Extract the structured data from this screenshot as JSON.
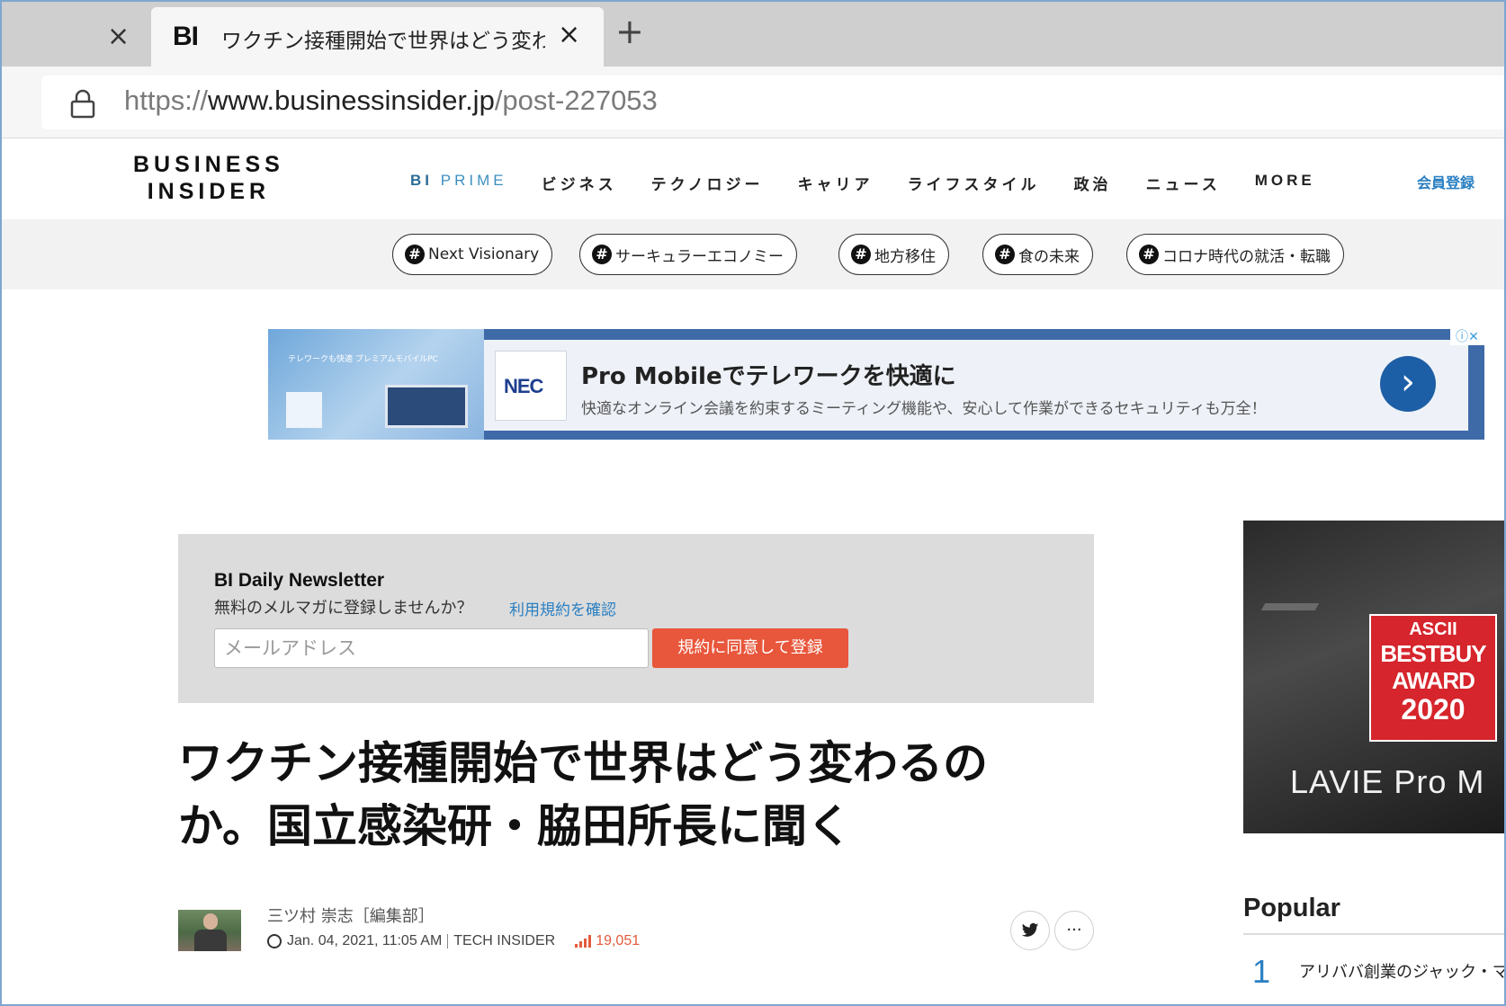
{
  "browser": {
    "closed_tab_close": "×",
    "active_tab": {
      "favicon": "BI",
      "title": "ワクチン接種開始で世界はどう変わる",
      "close": "×"
    },
    "new_tab": "+",
    "url_scheme": "https://",
    "url_domain": "www.businessinsider.jp",
    "url_path": "/post-227053"
  },
  "site": {
    "logo_line1": "BUSINESS",
    "logo_line2": "INSIDER",
    "nav": {
      "prime_bi": "BI",
      "prime": "PRIME",
      "items": [
        "ビジネス",
        "テクノロジー",
        "キャリア",
        "ライフスタイル",
        "政治",
        "ニュース",
        "MORE"
      ]
    },
    "member_link": "会員登録",
    "tags": [
      "Next Visionary",
      "サーキュラーエコノミー",
      "地方移住",
      "食の未来",
      "コロナ時代の就活・転職"
    ],
    "tag_hash": "#"
  },
  "ad": {
    "image_text": "テレワークも快適 プレミアムモバイルPC",
    "brand": "NEC",
    "title": "Pro Mobileでテレワークを快適に",
    "subtitle": "快適なオンライン会議を約束するミーティング機能や、安心して作業ができるセキュリティも万全！",
    "cta": "›",
    "adchoices": "ⓘ✕"
  },
  "newsletter": {
    "title": "BI Daily Newsletter",
    "subtitle": "無料のメルマガに登録しませんか？",
    "terms_link": "利用規約を確認",
    "email_placeholder": "メールアドレス",
    "submit_label": "規約に同意して登録"
  },
  "article": {
    "headline": "ワクチン接種開始で世界はどう変わるのか。国立感染研・脇田所長に聞く",
    "author": "三ツ村 崇志［編集部］",
    "date": "Jan. 04, 2021, 11:05 AM",
    "category": "TECH INSIDER",
    "views": "19,051",
    "share_twitter": "🐦",
    "share_more": "···"
  },
  "sidebar": {
    "award_brand": "ASCII",
    "award_line1": "BESTBUY",
    "award_line2": "AWARD",
    "award_year": "2020",
    "product_logo": "LAVIE Pro M",
    "popular_title": "Popular",
    "popular_items": [
      {
        "rank": "1",
        "text": "アリババ創業のジャック・マー氏 行方不明？「中国の金融規制は..."
      }
    ]
  },
  "colors": {
    "accent_blue": "#2a7fc2",
    "cta_orange": "#e8563b",
    "award_red": "#d6252c"
  }
}
